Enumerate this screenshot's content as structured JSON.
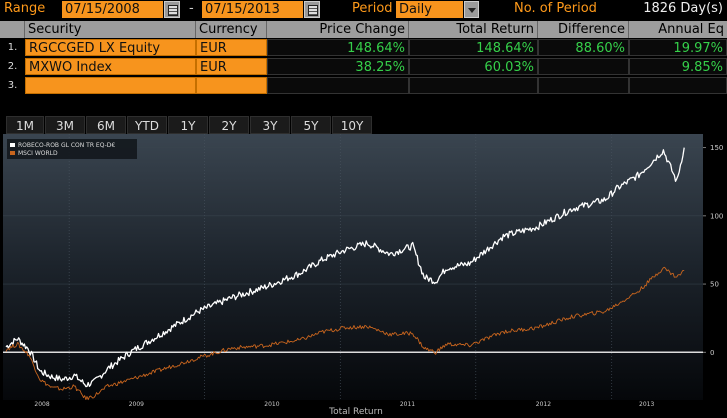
{
  "range_bar": {
    "range_label": "Range",
    "start_date": "07/15/2008",
    "separator": "-",
    "end_date": "07/15/2013",
    "period_label": "Period",
    "period_value": "Daily",
    "count_label": "No. of Period",
    "count_value": "1826 Day(s)"
  },
  "table": {
    "headers": [
      "Security",
      "Currency",
      "Price Change",
      "Total Return",
      "Difference",
      "Annual Eq"
    ],
    "rows": [
      {
        "index": "1.",
        "security": "RGCCGED LX Equity",
        "currency": "EUR",
        "price_change": "148.64%",
        "total_return": "148.64%",
        "difference": "88.60%",
        "annual_eq": "19.97%"
      },
      {
        "index": "2.",
        "security": "MXWO Index",
        "currency": "EUR",
        "price_change": "38.25%",
        "total_return": "60.03%",
        "difference": "",
        "annual_eq": "9.85%"
      },
      {
        "index": "3.",
        "security": "",
        "currency": "",
        "price_change": "",
        "total_return": "",
        "difference": "",
        "annual_eq": ""
      }
    ]
  },
  "periods": [
    "1M",
    "3M",
    "6M",
    "YTD",
    "1Y",
    "2Y",
    "3Y",
    "5Y",
    "10Y"
  ],
  "colors": {
    "accent_orange": "#f7941d",
    "positive_green": "#35d04a",
    "fund_line": "#ffffff",
    "index_line": "#c8651e",
    "zero_line": "#dddddd"
  },
  "chart_data": {
    "type": "line",
    "legend": [
      "ROBECO-ROB GL CON TR EQ-D€",
      "MSCI WORLD"
    ],
    "legend_position": "top-left",
    "xlabel": "Total Return",
    "x_ticks": [
      "2008",
      "2009",
      "2010",
      "2011",
      "2012",
      "2013"
    ],
    "y_ticks": [
      "150",
      "100",
      "50",
      "0"
    ],
    "ylim": [
      -35,
      160
    ],
    "series": [
      {
        "name": "ROBECO-ROB GL CON TR EQ-D€",
        "x": [
          "2008-07-15",
          "2008-08-15",
          "2008-09-15",
          "2008-10-15",
          "2008-11-15",
          "2008-12-15",
          "2009-01-15",
          "2009-02-15",
          "2009-03-09",
          "2009-04-15",
          "2009-06-15",
          "2009-09-15",
          "2009-12-15",
          "2010-03-15",
          "2010-06-15",
          "2010-09-15",
          "2010-11-15",
          "2011-01-15",
          "2011-03-15",
          "2011-05-15",
          "2011-07-15",
          "2011-08-15",
          "2011-09-15",
          "2011-10-15",
          "2011-12-15",
          "2012-03-15",
          "2012-06-15",
          "2012-09-15",
          "2012-12-15",
          "2013-01-15",
          "2013-03-15",
          "2013-05-20",
          "2013-06-25",
          "2013-07-15"
        ],
        "y": [
          4,
          10,
          2,
          -14,
          -18,
          -20,
          -17,
          -24,
          -22,
          -12,
          0,
          15,
          30,
          40,
          48,
          58,
          68,
          75,
          80,
          72,
          78,
          55,
          52,
          62,
          65,
          85,
          92,
          105,
          112,
          120,
          130,
          148,
          125,
          150
        ]
      },
      {
        "name": "MSCI WORLD",
        "x": [
          "2008-07-15",
          "2008-08-15",
          "2008-09-15",
          "2008-10-15",
          "2008-11-15",
          "2008-12-15",
          "2009-01-15",
          "2009-02-15",
          "2009-03-09",
          "2009-04-15",
          "2009-06-15",
          "2009-09-15",
          "2009-12-15",
          "2010-03-15",
          "2010-06-15",
          "2010-09-15",
          "2010-11-15",
          "2011-01-15",
          "2011-03-15",
          "2011-05-15",
          "2011-07-15",
          "2011-08-15",
          "2011-09-15",
          "2011-10-15",
          "2011-12-15",
          "2012-03-15",
          "2012-06-15",
          "2012-09-15",
          "2012-12-15",
          "2013-01-15",
          "2013-03-15",
          "2013-05-20",
          "2013-06-25",
          "2013-07-15"
        ],
        "y": [
          2,
          6,
          -2,
          -20,
          -26,
          -27,
          -25,
          -34,
          -32,
          -25,
          -20,
          -12,
          -4,
          3,
          5,
          9,
          15,
          18,
          19,
          13,
          14,
          3,
          0,
          6,
          5,
          15,
          18,
          26,
          30,
          35,
          45,
          62,
          55,
          60
        ]
      }
    ]
  }
}
